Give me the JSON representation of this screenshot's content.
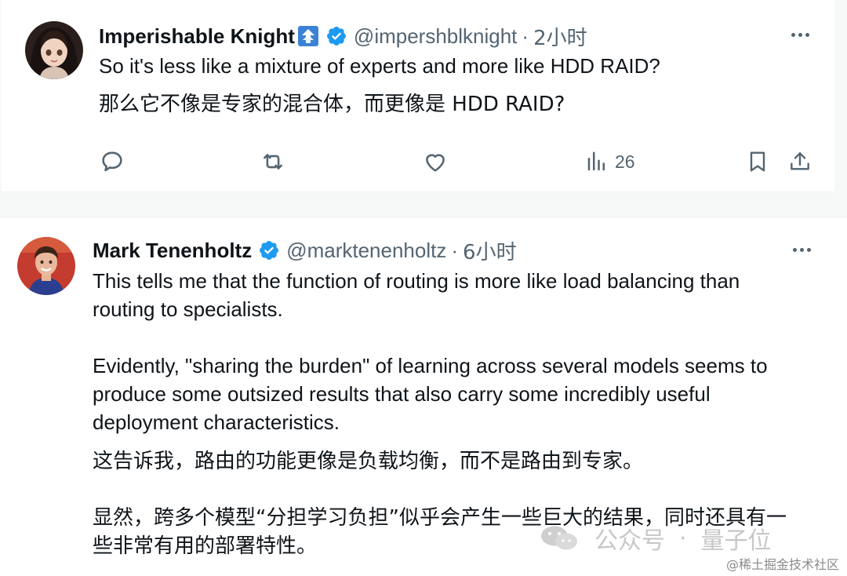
{
  "tweets": [
    {
      "author": {
        "display_name": "Imperishable Knight",
        "handle": "@impershblknight",
        "verified": true,
        "avatar": "anime-girl-avatar",
        "name_icon": "up-arrow-badge-icon"
      },
      "time": "2小时",
      "lines_en": [
        "So it's less like a mixture of experts and more like HDD RAID?"
      ],
      "lines_zh": [
        "那么它不像是专家的混合体，而更像是 HDD RAID?"
      ],
      "actions": {
        "reply": "reply-icon",
        "retweet": "retweet-icon",
        "like": "like-icon",
        "views": "views-icon",
        "views_count": "26",
        "bookmark": "bookmark-icon",
        "share": "share-icon"
      }
    },
    {
      "author": {
        "display_name": "Mark Tenenholtz",
        "handle": "@marktenenholtz",
        "verified": true,
        "avatar": "man-photo-avatar"
      },
      "time": "6小时",
      "lines_en": [
        "This tells me that the function of routing is more like load balancing than",
        "routing to specialists.",
        "",
        "Evidently, \"sharing the burden\" of learning across several models seems to",
        "produce some outsized results that also carry some incredibly useful",
        "deployment characteristics."
      ],
      "lines_zh": [
        "这告诉我，路由的功能更像是负载均衡，而不是路由到专家。",
        "",
        "显然，跨多个模型“分担学习负担”似乎会产生一些巨大的结果，同时还具有一",
        "些非常有用的部署特性。"
      ]
    }
  ],
  "separator": "·",
  "watermark": {
    "icon": "wechat-icon",
    "brand": "公众号",
    "separator": "·",
    "account": "量子位",
    "site": "@稀土掘金技术社区"
  },
  "colors": {
    "verified": "#1d9bf0",
    "secondary_text": "#536471",
    "primary_text": "#0f1419",
    "tag_badge": "#3b82d6"
  }
}
